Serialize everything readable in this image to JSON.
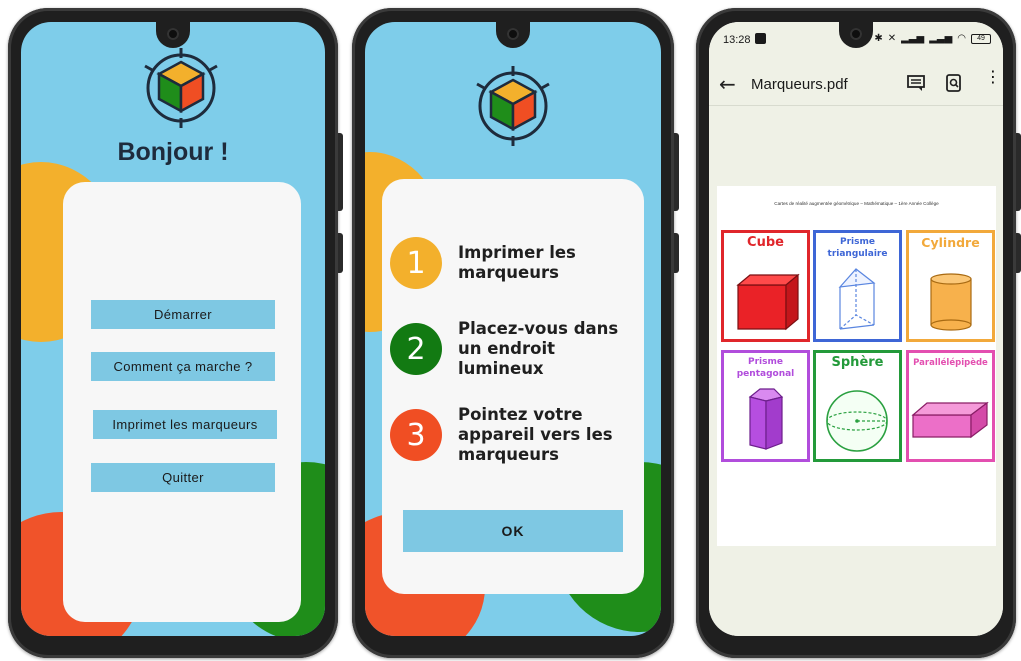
{
  "screen1": {
    "greeting": "Bonjour !",
    "buttons": [
      "Démarrer",
      "Comment ça marche ?",
      "Imprimet les marqueurs",
      "Quitter"
    ]
  },
  "screen2": {
    "steps": [
      {
        "number": "1",
        "text": "Imprimer les marqueurs",
        "color": "#f3b02c"
      },
      {
        "number": "2",
        "text": "Placez-vous dans un endroit lumineux",
        "color": "#127a12"
      },
      {
        "number": "3",
        "text": "Pointez votre appareil vers les marqueurs",
        "color": "#f04e23"
      }
    ],
    "ok_label": "OK"
  },
  "screen3": {
    "status_time": "13:28",
    "battery": "49",
    "title": "Marqueurs.pdf",
    "caption": "Cartes de réalité augmentée géométrique – Mathématique – 1ère Année Collège",
    "shapes": [
      {
        "label": "Cube",
        "color": "#e0262b"
      },
      {
        "label": "Prisme triangulaire",
        "color": "#3e66d6"
      },
      {
        "label": "Cylindre",
        "color": "#f2a93b"
      },
      {
        "label": "Prisme pentagonal",
        "color": "#b14ddc"
      },
      {
        "label": "Sphère",
        "color": "#239a3a"
      },
      {
        "label": "Parallélépipède",
        "color": "#e34fb0"
      }
    ]
  },
  "icons": [
    "cube-logo-icon",
    "back-arrow-icon",
    "comment-icon",
    "search-document-icon",
    "more-vert-icon",
    "bluetooth-icon",
    "mute-icon",
    "signal-icon",
    "wifi-icon",
    "battery-icon"
  ],
  "colors": {
    "app_background": "#7ecdea",
    "button": "#7ec8e3",
    "orange": "#f3b02c",
    "green": "#127a12",
    "red": "#f04e23"
  }
}
